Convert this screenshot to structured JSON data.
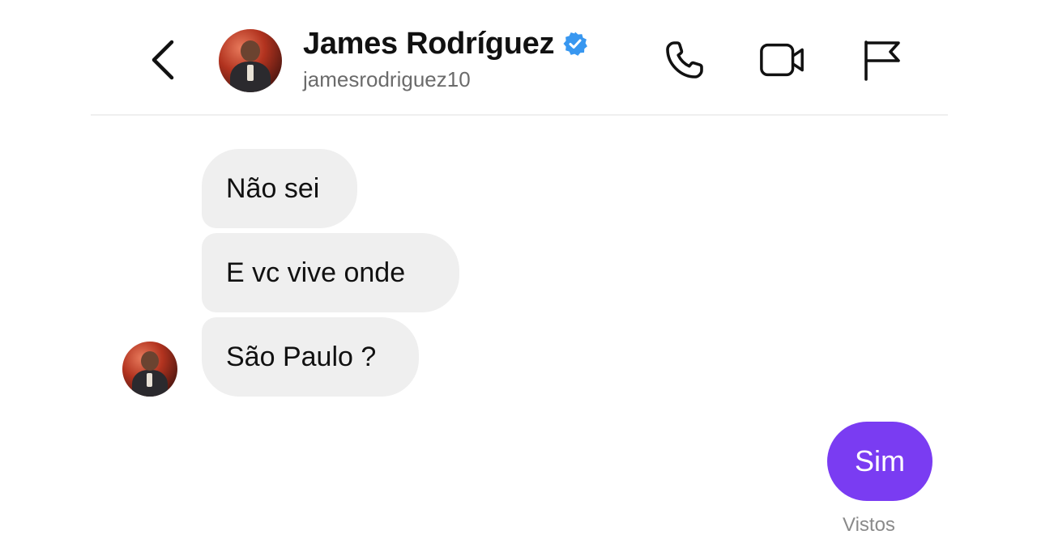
{
  "header": {
    "name": "James Rodríguez",
    "username": "jamesrodriguez10",
    "verified": true,
    "icons": [
      "back-icon",
      "phone-icon",
      "video-camera-icon",
      "flag-icon"
    ],
    "verified_color": "#3897f0"
  },
  "messages": {
    "received": [
      "Não sei",
      "E vc vive onde",
      "São Paulo ?"
    ],
    "sent": [
      "Sim"
    ],
    "seen_label": "Vistos"
  },
  "colors": {
    "received_bubble": "#efefef",
    "sent_bubble": "#7a3cf2",
    "text": "#111111"
  }
}
